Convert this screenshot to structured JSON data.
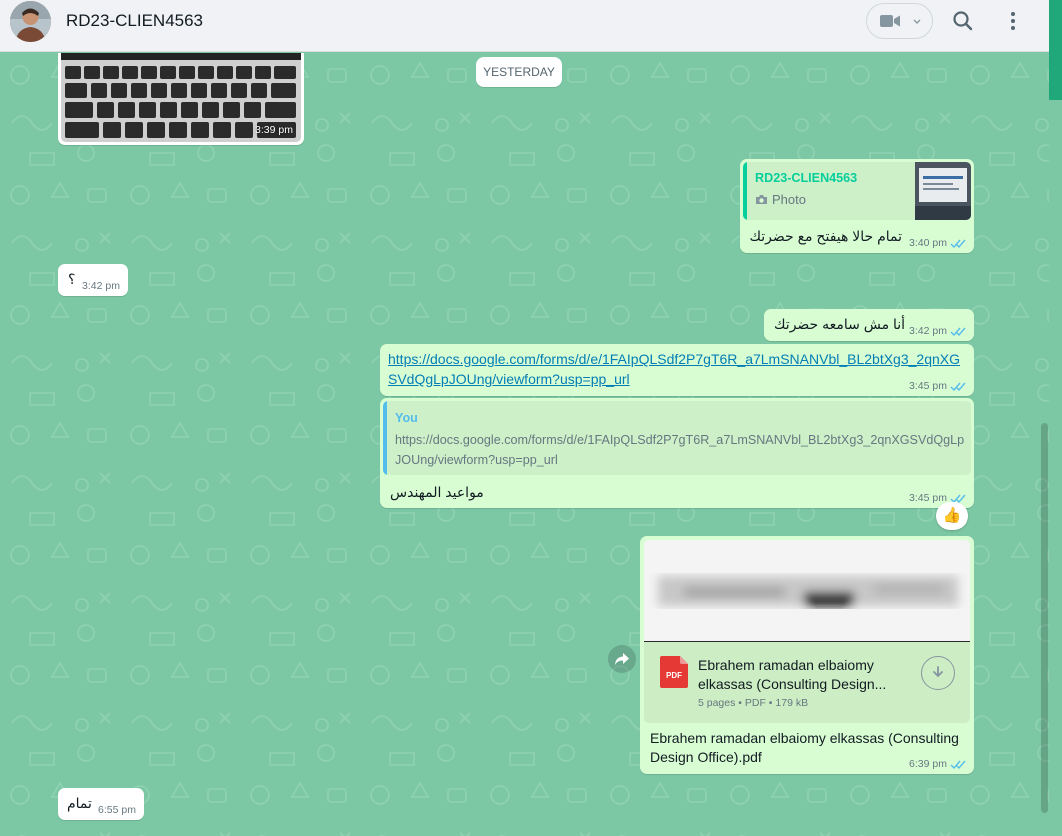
{
  "header": {
    "contact_name": "RD23-CLIEN4563",
    "icons": [
      "avatar",
      "video-call-icon",
      "chevron-down-icon",
      "search-icon",
      "menu-icon"
    ]
  },
  "colors": {
    "chat_bg": "#7dc8a4",
    "incoming": "#ffffff",
    "outgoing": "#d9fdd3",
    "accent_green": "#06cf9c",
    "read_tick": "#53bdeb",
    "link": "#027eb5"
  },
  "chat": {
    "date_separator": "YESTERDAY",
    "photo_message": {
      "time": "3:39 pm"
    },
    "reply_message": {
      "quoted_name": "RD23-CLIEN4563",
      "quoted_type": "Photo",
      "text": "تمام حالا هيفتح مع حضرتك",
      "time": "3:40 pm"
    },
    "question_message": {
      "text": "؟",
      "time": "3:42 pm"
    },
    "not_hearing_message": {
      "text": "أنا مش سامعه حضرتك",
      "time": "3:42 pm"
    },
    "link_message": {
      "url": "https://docs.google.com/forms/d/e/1FAIpQLSdf2P7gT6R_a7LmSNANVbl_BL2btXg3_2qnXGSVdQgLpJOUng/viewform?usp=pp_url",
      "time": "3:45 pm"
    },
    "quoted_link_message": {
      "quoted_name": "You",
      "quoted_text": "https://docs.google.com/forms/d/e/1FAIpQLSdf2P7gT6R_a7LmSNANVbl_BL2btXg3_2qnXGSVdQgLpJOUng/viewform?usp=pp_url",
      "text": "مواعيد المهندس",
      "time": "3:45 pm",
      "reaction": "👍"
    },
    "document_message": {
      "file_name": "Ebrahem ramadan elbaiomy elkassas (Consulting Design...",
      "file_info": "5 pages • PDF • 179 kB",
      "pdf_badge": "PDF",
      "caption": "Ebrahem ramadan elbaiomy elkassas (Consulting Design Office).pdf",
      "time": "6:39 pm"
    },
    "final_message": {
      "text": "تمام",
      "time": "6:55 pm"
    }
  }
}
